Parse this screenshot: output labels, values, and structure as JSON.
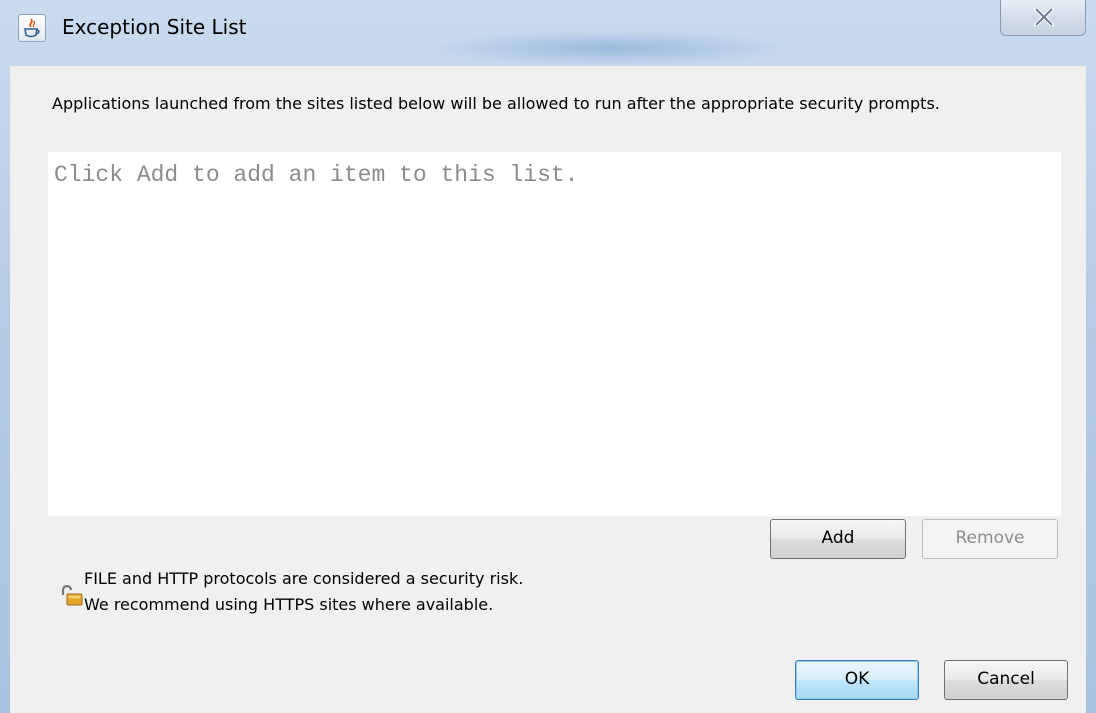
{
  "window": {
    "title": "Exception Site List",
    "icons": {
      "app": "java-icon",
      "close": "close-icon"
    }
  },
  "description": "Applications launched from the sites listed below will be allowed to run after the appropriate security prompts.",
  "site_list": {
    "items": [],
    "empty_text": "Click Add to add an item to this list."
  },
  "list_buttons": {
    "add_label": "Add",
    "remove_label": "Remove",
    "remove_enabled": false
  },
  "warning": {
    "icon": "unlocked-padlock-icon",
    "line1": "FILE and HTTP protocols are considered a security risk.",
    "line2": "We recommend using HTTPS sites where available."
  },
  "dialog_buttons": {
    "ok_label": "OK",
    "cancel_label": "Cancel",
    "default": "ok"
  },
  "colors": {
    "frame": "#b8cde6",
    "dialog_bg": "#f0f0f0",
    "list_bg": "#ffffff",
    "placeholder_text": "#8c8c8c",
    "default_button_border": "#3c7fb1"
  }
}
